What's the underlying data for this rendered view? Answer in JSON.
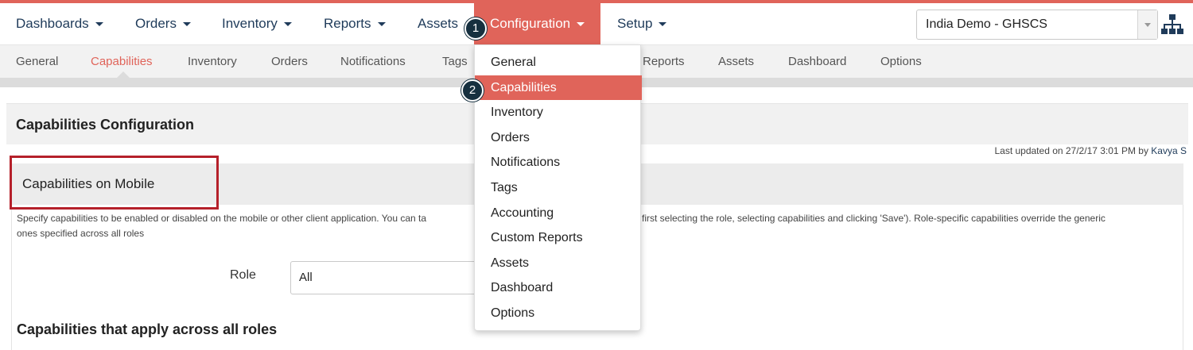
{
  "topnav": {
    "items": [
      {
        "label": "Dashboards"
      },
      {
        "label": "Orders"
      },
      {
        "label": "Inventory"
      },
      {
        "label": "Reports"
      },
      {
        "label": "Assets"
      },
      {
        "label": "Configuration"
      },
      {
        "label": "Setup"
      }
    ],
    "active_index": 5,
    "domain_select_value": "India Demo - GHSCS"
  },
  "subnav": {
    "items": [
      "General",
      "Capabilities",
      "Inventory",
      "Orders",
      "Notifications",
      "Tags",
      "Reports",
      "Assets",
      "Dashboard",
      "Options"
    ],
    "active": "Capabilities"
  },
  "dropdown": {
    "items": [
      "General",
      "Capabilities",
      "Inventory",
      "Orders",
      "Notifications",
      "Tags",
      "Accounting",
      "Custom Reports",
      "Assets",
      "Dashboard",
      "Options"
    ],
    "active": "Capabilities"
  },
  "steps": [
    "1",
    "2"
  ],
  "panel": {
    "title": "Capabilities Configuration",
    "last_updated_prefix": "Last updated on 27/2/17 3:01 PM by",
    "last_updated_user": "Kavya S"
  },
  "section": {
    "title": "Capabilities on Mobile",
    "desc_left": "Specify capabilities to be enabled or disabled on the mobile or other client application. You can ta",
    "desc_right": "first selecting the role, selecting capabilities and clicking 'Save'). Role-specific capabilities override the generic",
    "desc_line2": "ones specified across all roles",
    "role_label": "Role",
    "role_value": "All",
    "sub_heading": "Capabilities that apply across all roles"
  },
  "colors": {
    "accent": "#e0645a",
    "nav_text": "#1f3b5a",
    "badge": "#16303f",
    "highlight": "#b5202a"
  }
}
